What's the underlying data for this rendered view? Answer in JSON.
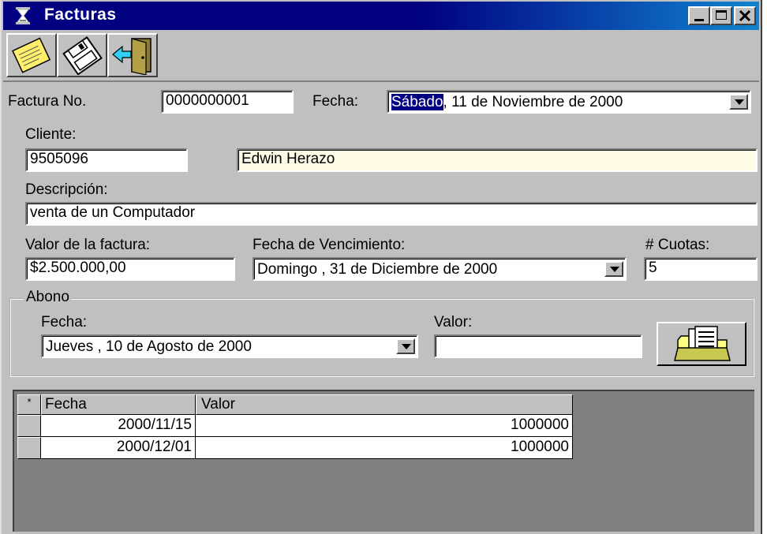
{
  "window": {
    "title": "Facturas"
  },
  "toolbar": {
    "buttons": [
      {
        "name": "new-note-button",
        "icon": "sticky-note-icon"
      },
      {
        "name": "save-button",
        "icon": "floppy-disk-icon"
      },
      {
        "name": "exit-button",
        "icon": "exit-door-icon"
      }
    ]
  },
  "form": {
    "factura_label": "Factura No.",
    "factura_value": "0000000001",
    "fecha_label": "Fecha:",
    "fecha_day_selected": "Sábado",
    "fecha_rest": ", 11 de Noviembre de 2000",
    "cliente_label": "Cliente:",
    "cliente_id": "9505096",
    "cliente_name": "Edwin Herazo",
    "descripcion_label": "Descripción:",
    "descripcion_value": "venta de un Computador",
    "valor_label": "Valor de la factura:",
    "valor_value": "$2.500.000,00",
    "vencimiento_label": "Fecha de Vencimiento:",
    "vencimiento_value": "Domingo , 31 de  Diciembre  de 2000",
    "cuotas_label": "# Cuotas:",
    "cuotas_value": "5"
  },
  "abono": {
    "group_label": "Abono",
    "fecha_label": "Fecha:",
    "fecha_value": "Jueves   , 10 de    Agosto    de 2000",
    "valor_label": "Valor:",
    "valor_value": ""
  },
  "grid": {
    "corner": "*",
    "columns": [
      "Fecha",
      "Valor"
    ],
    "rows": [
      {
        "fecha": "2000/11/15",
        "valor": "1000000"
      },
      {
        "fecha": "2000/12/01",
        "valor": "1000000"
      }
    ]
  },
  "colors": {
    "title_bar": "#000080",
    "face": "#c0c0c0",
    "name_field": "#fffbe6",
    "selection": "#000080"
  }
}
